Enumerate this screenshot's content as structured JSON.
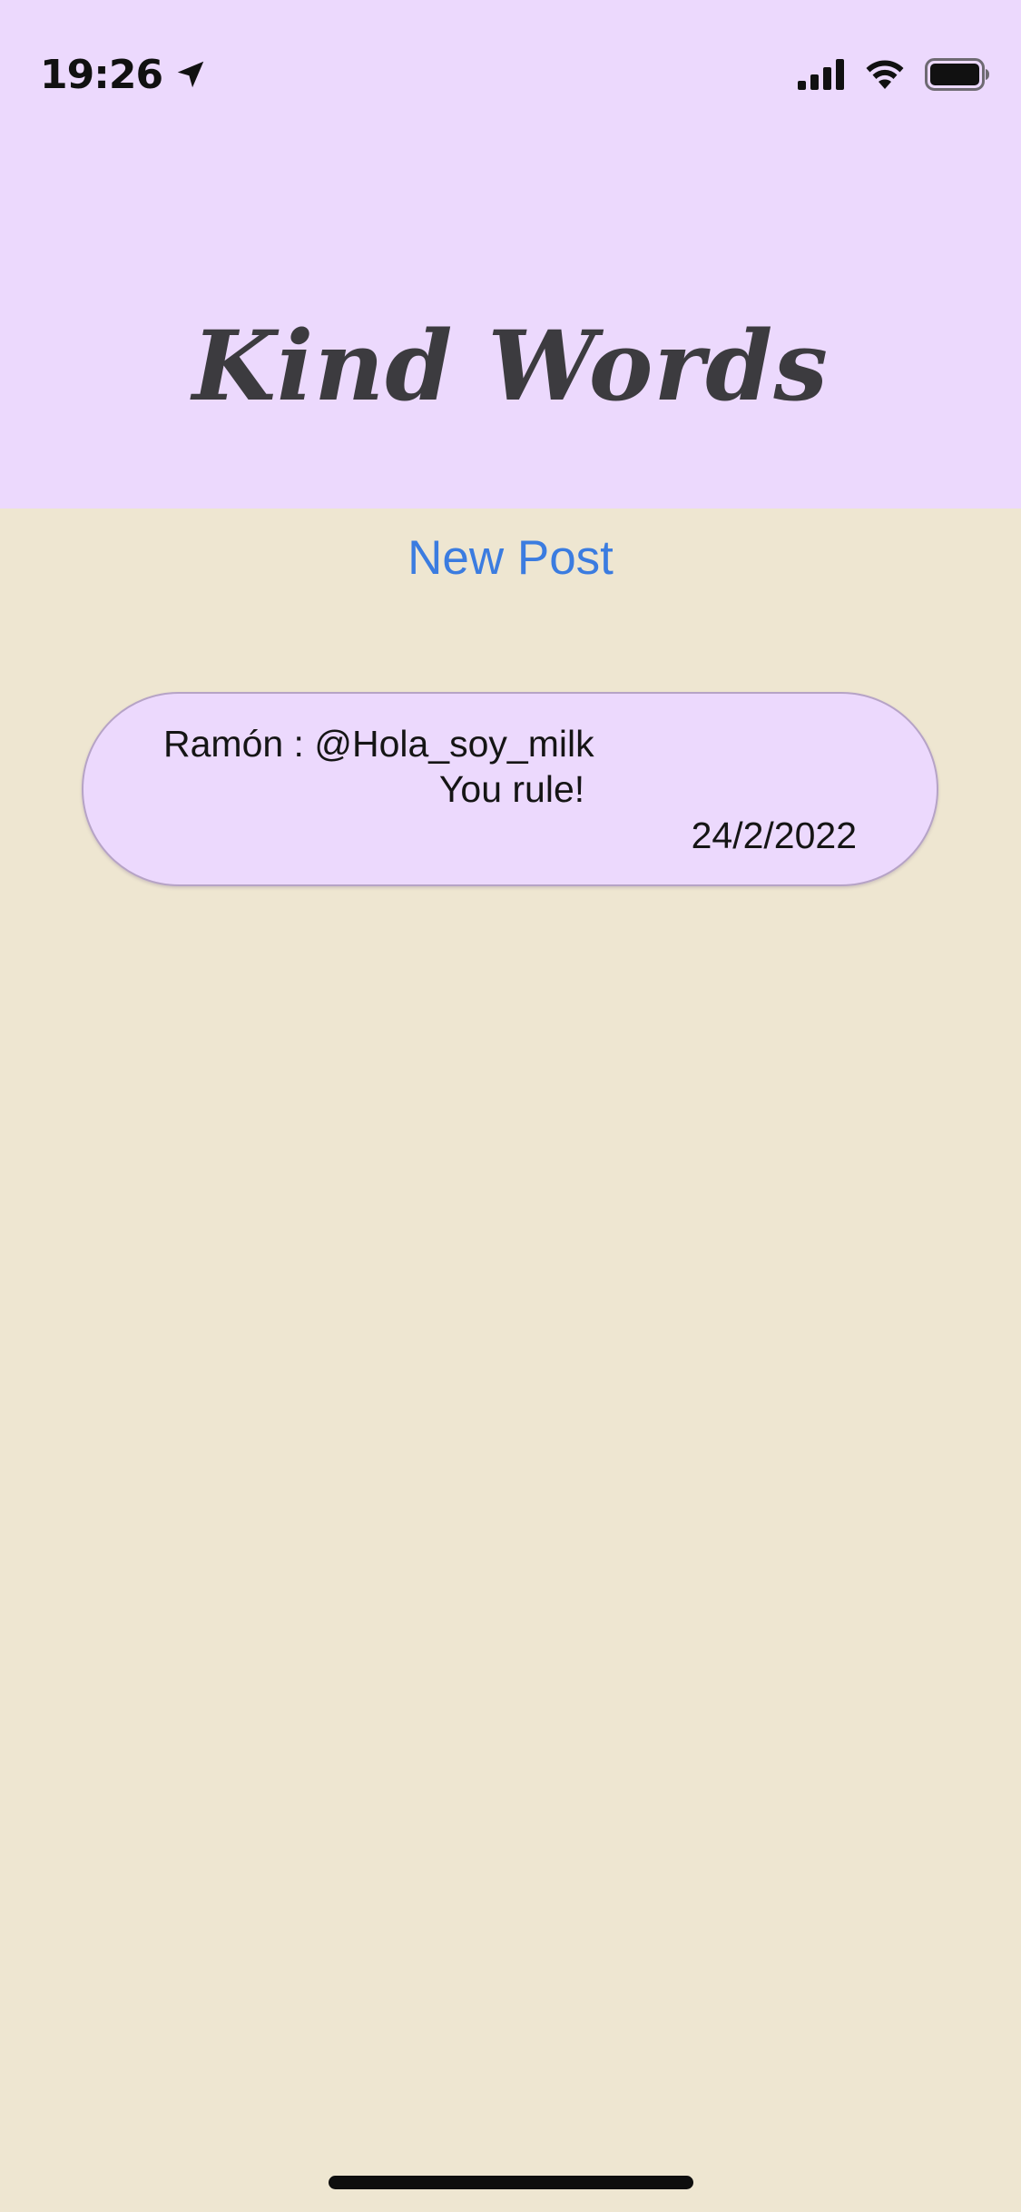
{
  "status_bar": {
    "time": "19:26",
    "icons": [
      "location-arrow-icon",
      "cellular-signal-icon",
      "wifi-icon",
      "battery-icon"
    ]
  },
  "header": {
    "title": "Kind Words",
    "background": "#ECD9FD"
  },
  "actions": {
    "new_post_label": "New Post",
    "link_color": "#3B7CE0"
  },
  "posts": [
    {
      "author_line": "Ramón : @Hola_soy_milk",
      "message": "You rule!",
      "date": "24/2/2022"
    }
  ],
  "colors": {
    "page_background": "#EEE6D1",
    "card_background": "#ECD9FD",
    "title_text": "#3C3B3F"
  }
}
